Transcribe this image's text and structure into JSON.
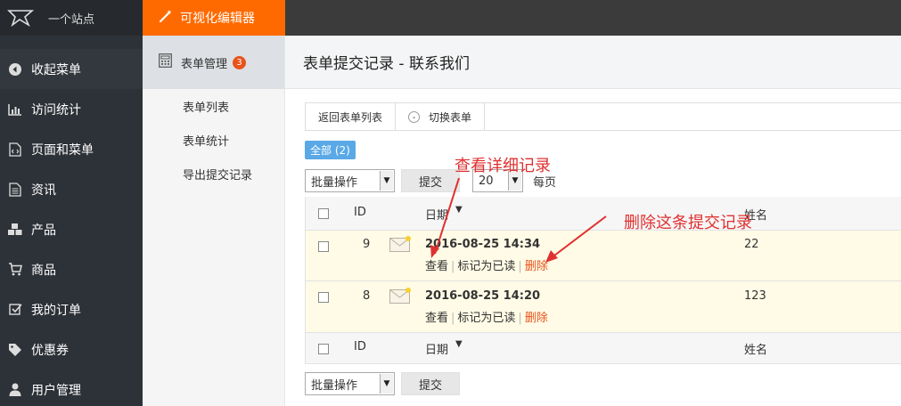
{
  "site": {
    "name": "一个站点"
  },
  "topbar": {
    "tab_label": "可视化编辑器"
  },
  "sidebar": {
    "items": [
      {
        "label": "收起菜单",
        "icon": "collapse-icon"
      },
      {
        "label": "访问统计",
        "icon": "bar-chart-icon"
      },
      {
        "label": "页面和菜单",
        "icon": "page-code-icon"
      },
      {
        "label": "资讯",
        "icon": "document-icon"
      },
      {
        "label": "产品",
        "icon": "cubes-icon"
      },
      {
        "label": "商品",
        "icon": "cart-icon"
      },
      {
        "label": "我的订单",
        "icon": "checkbox-icon"
      },
      {
        "label": "优惠券",
        "icon": "tag-icon"
      },
      {
        "label": "用户管理",
        "icon": "user-icon"
      }
    ]
  },
  "submenu": {
    "title": "表单管理",
    "badge": "3",
    "items": [
      "表单列表",
      "表单统计",
      "导出提交记录"
    ]
  },
  "page": {
    "title": "表单提交记录 - 联系我们"
  },
  "toolbar": {
    "back_label": "返回表单列表",
    "switch_label": "切换表单"
  },
  "filter": {
    "all_label": "全部 (2)"
  },
  "bulk": {
    "select_value": "批量操作",
    "submit_label": "提交",
    "per_page_value": "20",
    "per_page_label": "每页"
  },
  "table": {
    "columns": {
      "id": "ID",
      "date": "日期",
      "sort_icon": "▼",
      "name": "姓名"
    },
    "rows": [
      {
        "id": "9",
        "date": "2016-08-25 14:34",
        "name": "22",
        "action_view": "查看",
        "action_mark": "标记为已读",
        "action_delete": "删除"
      },
      {
        "id": "8",
        "date": "2016-08-25 14:20",
        "name": "123",
        "action_view": "查看",
        "action_mark": "标记为已读",
        "action_delete": "删除"
      }
    ]
  },
  "annotations": {
    "view_detail": "查看详细记录",
    "delete_record": "删除这条提交记录"
  },
  "colors": {
    "accent": "#ff6a00",
    "sidebar": "#2d3238",
    "delete": "#e8531b",
    "annotation": "#e03030",
    "row_highlight": "#fffbe6"
  }
}
